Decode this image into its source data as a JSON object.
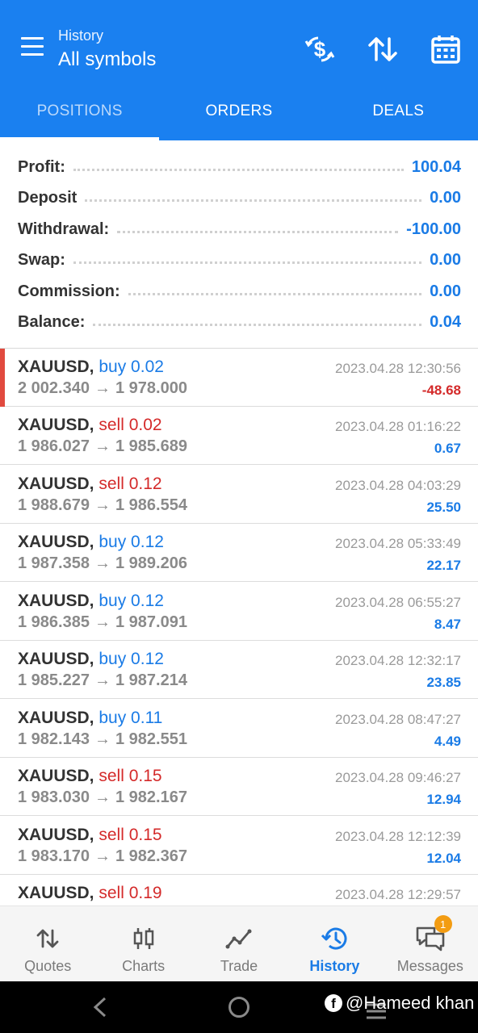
{
  "header": {
    "subtitle": "History",
    "title": "All symbols",
    "icons": [
      "currency-exchange-icon",
      "sort-icon",
      "calendar-icon"
    ]
  },
  "tabs": [
    {
      "label": "POSITIONS",
      "active": true
    },
    {
      "label": "ORDERS",
      "active": false
    },
    {
      "label": "DEALS",
      "active": false
    }
  ],
  "summary": [
    {
      "label": "Profit:",
      "value": "100.04"
    },
    {
      "label": "Deposit",
      "value": "0.00"
    },
    {
      "label": "Withdrawal:",
      "value": "-100.00"
    },
    {
      "label": "Swap:",
      "value": "0.00"
    },
    {
      "label": "Commission:",
      "value": "0.00"
    },
    {
      "label": "Balance:",
      "value": "0.04"
    }
  ],
  "deals": [
    {
      "symbol": "XAUUSD,",
      "side": "buy",
      "side_text": "buy 0.02",
      "open": "2 002.340",
      "close": "1 978.000",
      "time": "2023.04.28 12:30:56",
      "profit": "-48.68",
      "selected": true
    },
    {
      "symbol": "XAUUSD,",
      "side": "sell",
      "side_text": "sell 0.02",
      "open": "1 986.027",
      "close": "1 985.689",
      "time": "2023.04.28 01:16:22",
      "profit": "0.67"
    },
    {
      "symbol": "XAUUSD,",
      "side": "sell",
      "side_text": "sell 0.12",
      "open": "1 988.679",
      "close": "1 986.554",
      "time": "2023.04.28 04:03:29",
      "profit": "25.50"
    },
    {
      "symbol": "XAUUSD,",
      "side": "buy",
      "side_text": "buy 0.12",
      "open": "1 987.358",
      "close": "1 989.206",
      "time": "2023.04.28 05:33:49",
      "profit": "22.17"
    },
    {
      "symbol": "XAUUSD,",
      "side": "buy",
      "side_text": "buy 0.12",
      "open": "1 986.385",
      "close": "1 987.091",
      "time": "2023.04.28 06:55:27",
      "profit": "8.47"
    },
    {
      "symbol": "XAUUSD,",
      "side": "buy",
      "side_text": "buy 0.12",
      "open": "1 985.227",
      "close": "1 987.214",
      "time": "2023.04.28 12:32:17",
      "profit": "23.85"
    },
    {
      "symbol": "XAUUSD,",
      "side": "buy",
      "side_text": "buy 0.11",
      "open": "1 982.143",
      "close": "1 982.551",
      "time": "2023.04.28 08:47:27",
      "profit": "4.49"
    },
    {
      "symbol": "XAUUSD,",
      "side": "sell",
      "side_text": "sell 0.15",
      "open": "1 983.030",
      "close": "1 982.167",
      "time": "2023.04.28 09:46:27",
      "profit": "12.94"
    },
    {
      "symbol": "XAUUSD,",
      "side": "sell",
      "side_text": "sell 0.15",
      "open": "1 983.170",
      "close": "1 982.367",
      "time": "2023.04.28 12:12:39",
      "profit": "12.04"
    },
    {
      "symbol": "XAUUSD,",
      "side": "sell",
      "side_text": "sell 0.19",
      "open": "",
      "close": "",
      "time": "2023.04.28 12:29:57",
      "profit": ""
    }
  ],
  "bottom_nav": [
    {
      "label": "Quotes",
      "icon": "quotes-arrows-icon"
    },
    {
      "label": "Charts",
      "icon": "candlestick-icon"
    },
    {
      "label": "Trade",
      "icon": "trade-line-icon"
    },
    {
      "label": "History",
      "icon": "history-clock-icon",
      "active": true
    },
    {
      "label": "Messages",
      "icon": "chat-bubbles-icon",
      "badge": "1"
    }
  ],
  "watermark": "@Hameed khan",
  "colors": {
    "primary": "#1a80f0",
    "buy": "#1a7be6",
    "sell": "#d42a2a",
    "badge": "#f39c12"
  }
}
